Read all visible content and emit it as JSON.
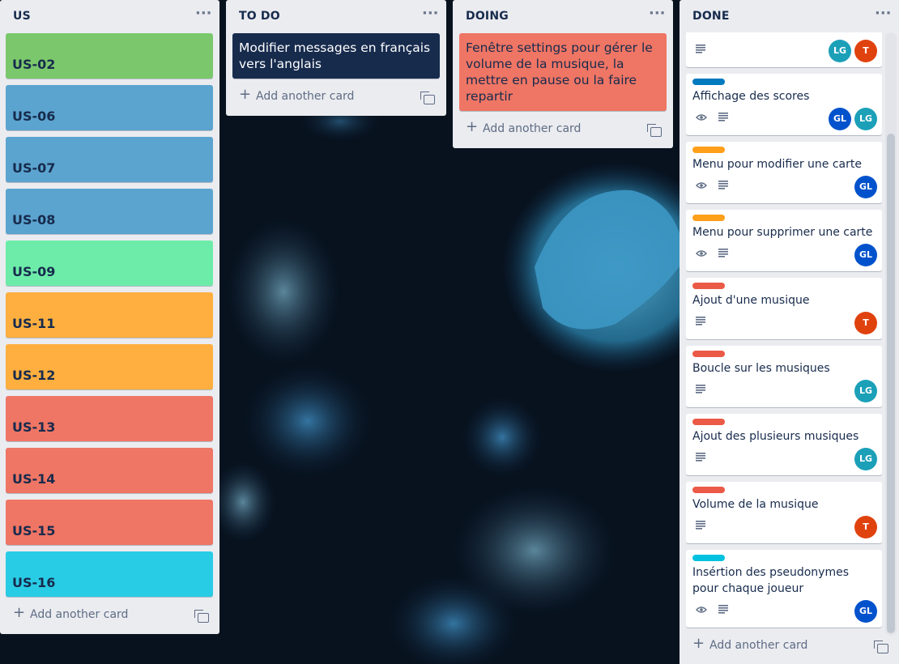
{
  "board": {
    "lists": [
      {
        "title": "US",
        "cards": [
          {
            "title": "US-02",
            "color": "#7bc86c"
          },
          {
            "title": "US-06",
            "color": "#5ba4cf"
          },
          {
            "title": "US-07",
            "color": "#5ba4cf"
          },
          {
            "title": "US-08",
            "color": "#5ba4cf"
          },
          {
            "title": "US-09",
            "color": "#6deca9"
          },
          {
            "title": "US-11",
            "color": "#ffaf3f"
          },
          {
            "title": "US-12",
            "color": "#ffaf3f"
          },
          {
            "title": "US-13",
            "color": "#ef7564"
          },
          {
            "title": "US-14",
            "color": "#ef7564"
          },
          {
            "title": "US-15",
            "color": "#ef7564"
          },
          {
            "title": "US-16",
            "color": "#29cce5"
          }
        ],
        "add_label": "Add another card"
      },
      {
        "title": "TO DO",
        "cards": [
          {
            "title": "Modifier messages en français vers l'anglais",
            "color": "#172b4d",
            "text_color": "#ffffff"
          }
        ],
        "add_label": "Add another card"
      },
      {
        "title": "DOING",
        "cards": [
          {
            "title": "Fenêtre settings pour gérer le volume de la musique, la mettre en pause ou la faire repartir",
            "color": "#ef7564",
            "text_color": "#172b4d"
          }
        ],
        "add_label": "Add another card"
      },
      {
        "title": "DONE",
        "cards": [
          {
            "title": "",
            "label_color": "",
            "watch": false,
            "description": true,
            "members": [
              "LG",
              "T"
            ]
          },
          {
            "title": "Affichage des scores",
            "label_color": "#0079bf",
            "watch": true,
            "description": true,
            "members": [
              "GL",
              "LG"
            ]
          },
          {
            "title": "Menu pour modifier une carte",
            "label_color": "#ff9f1a",
            "watch": true,
            "description": true,
            "members": [
              "GL"
            ]
          },
          {
            "title": "Menu pour supprimer une carte",
            "label_color": "#ff9f1a",
            "watch": true,
            "description": true,
            "members": [
              "GL"
            ]
          },
          {
            "title": "Ajout d'une musique",
            "label_color": "#eb5a46",
            "watch": false,
            "description": true,
            "members": [
              "T"
            ]
          },
          {
            "title": "Boucle sur les musiques",
            "label_color": "#eb5a46",
            "watch": false,
            "description": true,
            "members": [
              "LG"
            ]
          },
          {
            "title": "Ajout des plusieurs musiques",
            "label_color": "#eb5a46",
            "watch": false,
            "description": true,
            "members": [
              "LG"
            ]
          },
          {
            "title": "Volume de la musique",
            "label_color": "#eb5a46",
            "watch": false,
            "description": true,
            "members": [
              "T"
            ]
          },
          {
            "title": "Insértion des pseudonymes pour chaque joueur",
            "label_color": "#00c2e0",
            "watch": true,
            "description": true,
            "members": [
              "GL"
            ]
          }
        ],
        "add_label": "Add another card"
      }
    ],
    "member_colors": {
      "LG": "#1ba0b8",
      "T": "#e0420e",
      "GL": "#0052cc"
    },
    "menu_glyph": "···",
    "add_glyph": "+"
  }
}
